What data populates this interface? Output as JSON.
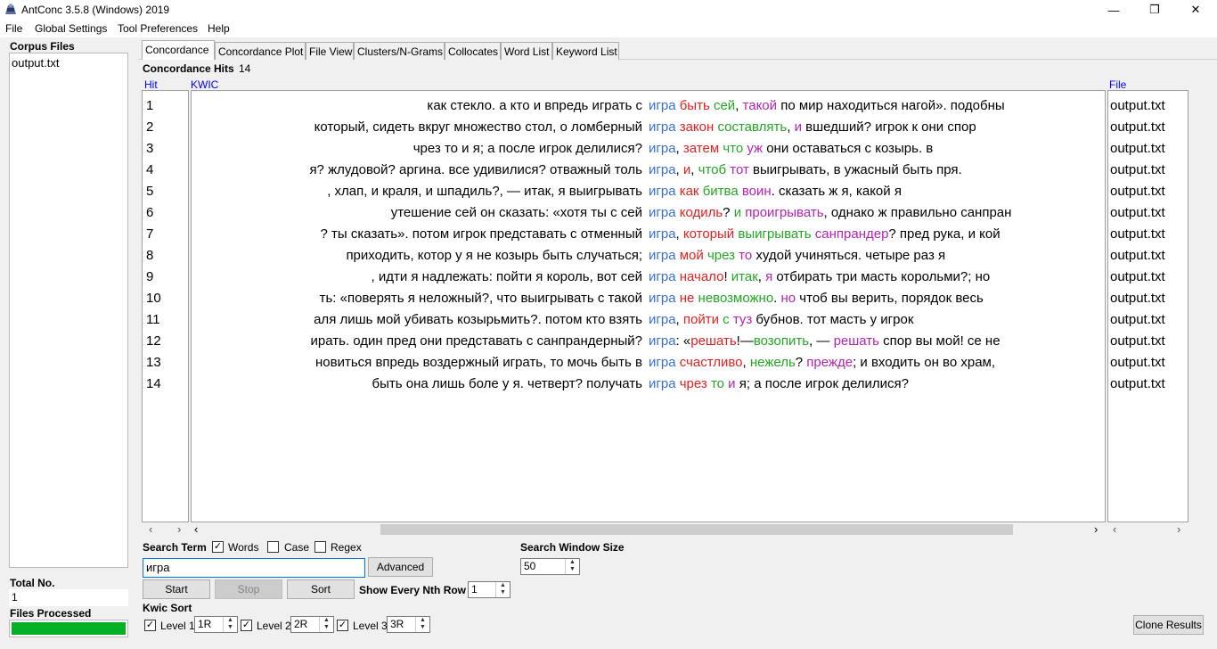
{
  "window": {
    "title": "AntConc 3.5.8 (Windows) 2019",
    "minimize": "—",
    "maximize": "❐",
    "close": "✕"
  },
  "menu": [
    "File",
    "Global Settings",
    "Tool Preferences",
    "Help"
  ],
  "left_panel": {
    "corpus_files_label": "Corpus Files",
    "files": [
      "output.txt"
    ],
    "total_no_label": "Total No.",
    "total_no_value": "1",
    "files_processed_label": "Files Processed",
    "files_processed_progress": 1.0
  },
  "tabs": [
    "Concordance",
    "Concordance Plot",
    "File View",
    "Clusters/N-Grams",
    "Collocates",
    "Word List",
    "Keyword List"
  ],
  "active_tab": "Concordance",
  "concordance": {
    "hits_label": "Concordance Hits",
    "hits_count": "14",
    "col_hit": "Hit",
    "col_kwic": "KWIC",
    "col_file": "File",
    "rows": [
      {
        "hit": "1",
        "left": "как стекло.  а кто и впредь играть с",
        "right": [
          [
            "kw",
            "игра"
          ],
          [
            "t",
            " "
          ],
          [
            "c1",
            "быть"
          ],
          [
            "t",
            " "
          ],
          [
            "c2",
            "сей"
          ],
          [
            "t",
            ", "
          ],
          [
            "c3",
            "такой"
          ],
          [
            "t",
            " по мир находиться нагой». подобны"
          ]
        ],
        "file": "output.txt"
      },
      {
        "hit": "2",
        "left": "который, сидеть вкруг множество стол, о ломберный",
        "right": [
          [
            "kw",
            "игра"
          ],
          [
            "t",
            " "
          ],
          [
            "c1",
            "закон"
          ],
          [
            "t",
            " "
          ],
          [
            "c2",
            "составлять"
          ],
          [
            "t",
            ", "
          ],
          [
            "c3",
            "и"
          ],
          [
            "t",
            " вшедший? игрок к они спор"
          ]
        ],
        "file": "output.txt"
      },
      {
        "hit": "3",
        "left": "чрез то и я; а после игрок делилися?",
        "right": [
          [
            "kw",
            "игра"
          ],
          [
            "t",
            ", "
          ],
          [
            "c1",
            "затем"
          ],
          [
            "t",
            " "
          ],
          [
            "c2",
            "что"
          ],
          [
            "t",
            " "
          ],
          [
            "c3",
            "уж"
          ],
          [
            "t",
            " они оставаться с козырь. в"
          ]
        ],
        "file": "output.txt"
      },
      {
        "hit": "4",
        "left": "я? жлудовой? аргина. все удивилися? отважный толь",
        "right": [
          [
            "kw",
            "игра"
          ],
          [
            "t",
            ", "
          ],
          [
            "c1",
            "и"
          ],
          [
            "t",
            ", "
          ],
          [
            "c2",
            "чтоб"
          ],
          [
            "t",
            " "
          ],
          [
            "c3",
            "тот"
          ],
          [
            "t",
            " выигрывать, в ужасный быть пря."
          ]
        ],
        "file": "output.txt"
      },
      {
        "hit": "5",
        "left": ", хлап, и краля, и шпадиль?, — итак, я выигрывать",
        "right": [
          [
            "kw",
            "игра"
          ],
          [
            "t",
            " "
          ],
          [
            "c1",
            "как"
          ],
          [
            "t",
            " "
          ],
          [
            "c2",
            "битва"
          ],
          [
            "t",
            " "
          ],
          [
            "c3",
            "воин"
          ],
          [
            "t",
            ". сказать ж я, какой я"
          ]
        ],
        "file": "output.txt"
      },
      {
        "hit": "6",
        "left": "утешение сей он сказать: «хотя ты с сей",
        "right": [
          [
            "kw",
            "игра"
          ],
          [
            "t",
            " "
          ],
          [
            "c1",
            "кодиль"
          ],
          [
            "t",
            "? "
          ],
          [
            "c2",
            "и"
          ],
          [
            "t",
            " "
          ],
          [
            "c3",
            "проигрывать"
          ],
          [
            "t",
            ", однако ж правильно санпран"
          ]
        ],
        "file": "output.txt"
      },
      {
        "hit": "7",
        "left": "? ты сказать». потом игрок представать с отменный",
        "right": [
          [
            "kw",
            "игра"
          ],
          [
            "t",
            ", "
          ],
          [
            "c1",
            "который"
          ],
          [
            "t",
            " "
          ],
          [
            "c2",
            "выигрывать"
          ],
          [
            "t",
            " "
          ],
          [
            "c3",
            "санпрандер"
          ],
          [
            "t",
            "? пред рука, и кой"
          ]
        ],
        "file": "output.txt"
      },
      {
        "hit": "8",
        "left": "приходить, котор у я не козырь быть случаться;",
        "right": [
          [
            "kw",
            "игра"
          ],
          [
            "t",
            " "
          ],
          [
            "c1",
            "мой"
          ],
          [
            "t",
            " "
          ],
          [
            "c2",
            "чрез"
          ],
          [
            "t",
            " "
          ],
          [
            "c3",
            "то"
          ],
          [
            "t",
            " худой учиняться. четыре раз я"
          ]
        ],
        "file": "output.txt"
      },
      {
        "hit": "9",
        "left": ", идти я надлежать: пойти я король, вот сей",
        "right": [
          [
            "kw",
            "игра"
          ],
          [
            "t",
            " "
          ],
          [
            "c1",
            "начало"
          ],
          [
            "t",
            "! "
          ],
          [
            "c2",
            "итак"
          ],
          [
            "t",
            ", "
          ],
          [
            "c3",
            "я"
          ],
          [
            "t",
            " отбирать три масть корольми?; но"
          ]
        ],
        "file": "output.txt"
      },
      {
        "hit": "10",
        "left": "ть: «поверять я неложный?, что выигрывать с такой",
        "right": [
          [
            "kw",
            "игра"
          ],
          [
            "t",
            " "
          ],
          [
            "c1",
            "не"
          ],
          [
            "t",
            " "
          ],
          [
            "c2",
            "невозможно"
          ],
          [
            "t",
            ". "
          ],
          [
            "c3",
            "но"
          ],
          [
            "t",
            " чтоб вы верить, порядок весь"
          ]
        ],
        "file": "output.txt"
      },
      {
        "hit": "11",
        "left": "аля лишь мой убивать козырьмить?. потом кто взять",
        "right": [
          [
            "kw",
            "игра"
          ],
          [
            "t",
            ", "
          ],
          [
            "c1",
            "пойти"
          ],
          [
            "t",
            " "
          ],
          [
            "c2",
            "с"
          ],
          [
            "t",
            " "
          ],
          [
            "c3",
            "туз"
          ],
          [
            "t",
            " бубнов. тот масть у игрок"
          ]
        ],
        "file": "output.txt"
      },
      {
        "hit": "12",
        "left": "ирать. один пред они представать с санпрандерный?",
        "right": [
          [
            "kw",
            "игра"
          ],
          [
            "t",
            ": «"
          ],
          [
            "c1",
            "решать"
          ],
          [
            "t",
            "!—"
          ],
          [
            "c2",
            "возопить"
          ],
          [
            "t",
            ", — "
          ],
          [
            "c3",
            "решать"
          ],
          [
            "t",
            " спор вы мой! се не"
          ]
        ],
        "file": "output.txt"
      },
      {
        "hit": "13",
        "left": "новиться впредь воздержный играть, то мочь быть в",
        "right": [
          [
            "kw",
            "игра"
          ],
          [
            "t",
            " "
          ],
          [
            "c1",
            "счастливо"
          ],
          [
            "t",
            ", "
          ],
          [
            "c2",
            "нежель"
          ],
          [
            "t",
            "? "
          ],
          [
            "c3",
            "прежде"
          ],
          [
            "t",
            "; и входить он во храм,"
          ]
        ],
        "file": "output.txt"
      },
      {
        "hit": "14",
        "left": "быть она лишь боле у я. четверт? получать",
        "right": [
          [
            "kw",
            "игра"
          ],
          [
            "t",
            " "
          ],
          [
            "c1",
            "чрез"
          ],
          [
            "t",
            " "
          ],
          [
            "c2",
            "то"
          ],
          [
            "t",
            " "
          ],
          [
            "c3",
            "и"
          ],
          [
            "t",
            " я; а после игрок делилися?"
          ]
        ],
        "file": "output.txt"
      }
    ]
  },
  "controls": {
    "search_term_label": "Search Term",
    "words_label": "Words",
    "words_checked": true,
    "case_label": "Case",
    "case_checked": false,
    "regex_label": "Regex",
    "regex_checked": false,
    "search_value": "игра",
    "advanced_label": "Advanced",
    "search_window_label": "Search Window Size",
    "search_window_value": "50",
    "start_label": "Start",
    "stop_label": "Stop",
    "sort_label": "Sort",
    "nth_row_label": "Show Every Nth Row",
    "nth_row_value": "1",
    "kwic_sort_label": "Kwic Sort",
    "level1_label": "Level 1",
    "level1_value": "1R",
    "level2_label": "Level 2",
    "level2_value": "2R",
    "level3_label": "Level 3",
    "level3_value": "3R",
    "clone_label": "Clone Results",
    "check_mark": "✓",
    "scroll_left": "‹",
    "scroll_right": "›",
    "spin_up": "▲",
    "spin_down": "▼"
  },
  "colors": {
    "keyword": "#3b6fd6",
    "level1": "#e52020",
    "level2": "#23a623",
    "level3": "#b524b5",
    "progress": "#06b025",
    "header_link": "#0000ff"
  }
}
